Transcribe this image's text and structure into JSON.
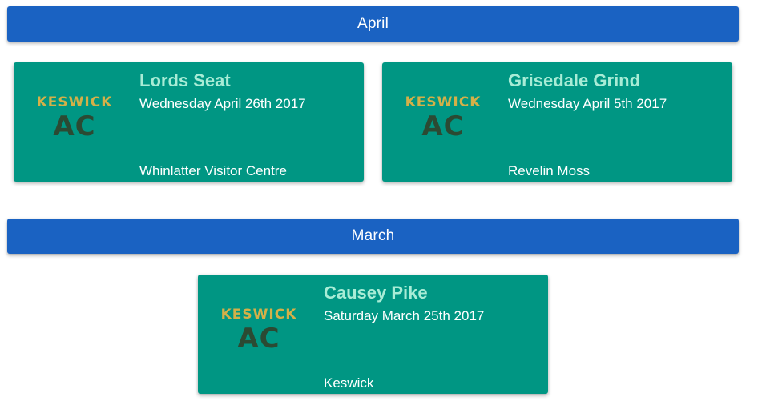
{
  "colors": {
    "header_bg": "#1a62c2",
    "card_bg": "#009683",
    "title_color": "#a8ecd6",
    "logo_top_color": "#d4b048",
    "logo_bottom_color": "#2b4a33"
  },
  "sections": [
    {
      "month": "April",
      "events": [
        {
          "title": "Lords Seat",
          "date": "Wednesday April 26th 2017",
          "location": "Whinlatter Visitor Centre",
          "logo": {
            "top": "KESWICK",
            "bottom": "AC"
          }
        },
        {
          "title": "Grisedale Grind",
          "date": "Wednesday April 5th 2017",
          "location": "Revelin Moss",
          "logo": {
            "top": "KESWICK",
            "bottom": "AC"
          }
        }
      ]
    },
    {
      "month": "March",
      "events": [
        {
          "title": "Causey Pike",
          "date": "Saturday March 25th 2017",
          "location": "Keswick",
          "logo": {
            "top": "KESWICK",
            "bottom": "AC"
          }
        }
      ]
    }
  ]
}
